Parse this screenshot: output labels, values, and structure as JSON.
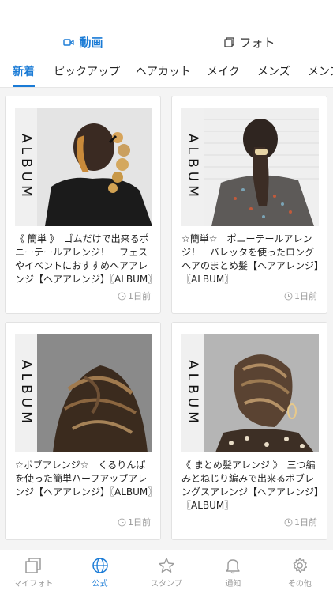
{
  "header": {
    "modes": [
      {
        "label": "動画",
        "icon": "video-icon",
        "active": true
      },
      {
        "label": "フォト",
        "icon": "photo-icon",
        "active": false
      }
    ],
    "tabs": [
      {
        "label": "新着",
        "active": true
      },
      {
        "label": "ピックアップ",
        "active": false
      },
      {
        "label": "ヘアカット",
        "active": false
      },
      {
        "label": "メイク",
        "active": false
      },
      {
        "label": "メンズ",
        "active": false
      },
      {
        "label": "メンズ",
        "active": false
      }
    ]
  },
  "cards": [
    {
      "badge": "ALBUM",
      "description": "《 簡単 》　ゴムだけで出来るポニーテールアレンジ！　フェスやイベントにおすすめヘアアレンジ【ヘアアレンジ】〖ALBUM〗",
      "time": "1日前"
    },
    {
      "badge": "ALBUM",
      "description": "☆簡単☆　ポニーテールアレンジ！　バレッタを使ったロングヘアのまとめ髪【ヘアアレンジ】〖ALBUM〗",
      "time": "1日前"
    },
    {
      "badge": "ALBUM",
      "description": "☆ボブアレンジ☆　くるりんぱを使った簡単ハーフアップアレンジ【ヘアアレンジ】〖ALBUM〗",
      "time": "1日前"
    },
    {
      "badge": "ALBUM",
      "description": "《 まとめ髪アレンジ 》　三つ編みとねじり編みで出来るボブレングスアレンジ【ヘアアレンジ】〖ALBUM〗",
      "time": "1日前"
    }
  ],
  "bottom_nav": [
    {
      "label": "マイフォト",
      "icon": "my-photo-icon",
      "active": false
    },
    {
      "label": "公式",
      "icon": "globe-icon",
      "active": true
    },
    {
      "label": "スタンプ",
      "icon": "star-icon",
      "active": false
    },
    {
      "label": "通知",
      "icon": "bell-icon",
      "active": false
    },
    {
      "label": "その他",
      "icon": "gear-icon",
      "active": false
    }
  ],
  "colors": {
    "accent": "#1a7bd6",
    "inactive": "#9b9b9b"
  }
}
